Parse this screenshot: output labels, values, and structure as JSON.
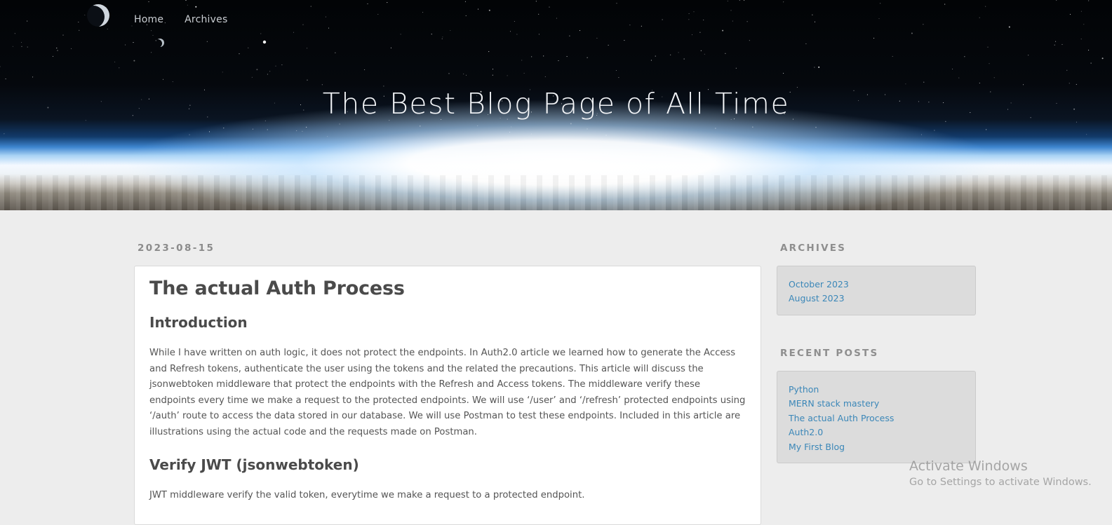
{
  "nav": {
    "items": [
      {
        "label": "Home"
      },
      {
        "label": "Archives"
      }
    ]
  },
  "site": {
    "title": "The Best Blog Page of All Time"
  },
  "post": {
    "date": "2023-08-15",
    "title": "The actual Auth Process",
    "sections": [
      {
        "heading": "Introduction",
        "body": "While I have written on auth logic, it does not protect the endpoints. In Auth2.0 article we learned how to generate the Access and Refresh tokens, authenticate the user using the tokens and the related the precautions. This article will discuss the jsonwebtoken middleware that protect the endpoints with the Refresh and Access tokens. The middleware verify these endpoints every time we make a request to the protected endpoints. We will use ‘/user’ and ‘/refresh’ protected endpoints using ‘/auth’ route to access the data stored in our database. We will use Postman to test these endpoints. Included in this article are illustrations using the actual code and the requests made on Postman."
      },
      {
        "heading": "Verify JWT (jsonwebtoken)",
        "body": "JWT middleware verify the valid token, everytime we make a request to a protected endpoint."
      }
    ]
  },
  "sidebar": {
    "archives": {
      "heading": "ARCHIVES",
      "links": [
        {
          "label": "October 2023"
        },
        {
          "label": "August 2023"
        }
      ]
    },
    "recent_posts": {
      "heading": "RECENT POSTS",
      "links": [
        {
          "label": "Python"
        },
        {
          "label": "MERN stack mastery"
        },
        {
          "label": "The actual Auth Process"
        },
        {
          "label": "Auth2.0"
        },
        {
          "label": "My First Blog"
        }
      ]
    }
  },
  "watermark": {
    "title": "Activate Windows",
    "subtitle": "Go to Settings to activate Windows."
  },
  "colors": {
    "background": "#ededed",
    "link": "#3b87b8",
    "sidebar_box": "#dcdcdc",
    "heading_text": "#4a4a4a"
  }
}
